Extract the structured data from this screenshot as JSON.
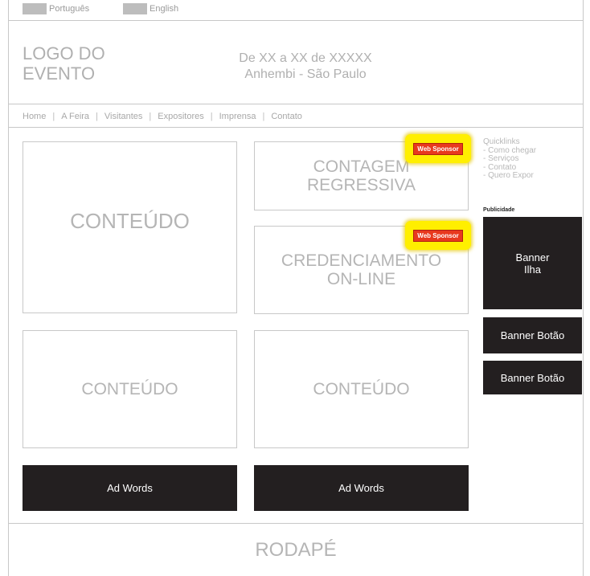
{
  "languages": [
    {
      "label": "Português"
    },
    {
      "label": "English"
    }
  ],
  "header": {
    "logo_line1": "LOGO DO",
    "logo_line2": "EVENTO",
    "date_text": "De XX a XX de XXXXX",
    "venue_text": "Anhembi - São Paulo"
  },
  "nav": {
    "items": [
      "Home",
      "A Feira",
      "Visitantes",
      "Expositores",
      "Imprensa",
      "Contato"
    ],
    "separator": "|"
  },
  "content": {
    "main_box": "CONTEÚDO",
    "countdown_line1": "CONTAGEM",
    "countdown_line2": "REGRESSIVA",
    "credential_line1": "CREDENCIAMENTO",
    "credential_line2": "ON-LINE",
    "content_box_2": "CONTEÚDO",
    "content_box_3": "CONTEÚDO"
  },
  "sponsors": [
    {
      "label": "Web Sponsor"
    },
    {
      "label": "Web Sponsor"
    }
  ],
  "quicklinks": {
    "title": "Quicklinks",
    "items": [
      "- Como chegar",
      "- Serviços",
      "- Contato",
      "- Quero Expor"
    ]
  },
  "publicidade": {
    "label": "Publicidade",
    "banner_ilha_line1": "Banner",
    "banner_ilha_line2": "Ilha",
    "banner_botao_1": "Banner Botão",
    "banner_botao_2": "Banner Botão"
  },
  "ads": [
    "Ad Words",
    "Ad Words"
  ],
  "footer": {
    "label": "RODAPÉ"
  },
  "colors": {
    "dark_block": "#231f20",
    "sponsor_highlight": "#ffef00",
    "sponsor_badge": "#e8391e",
    "wire_line": "#c8c8c8"
  }
}
